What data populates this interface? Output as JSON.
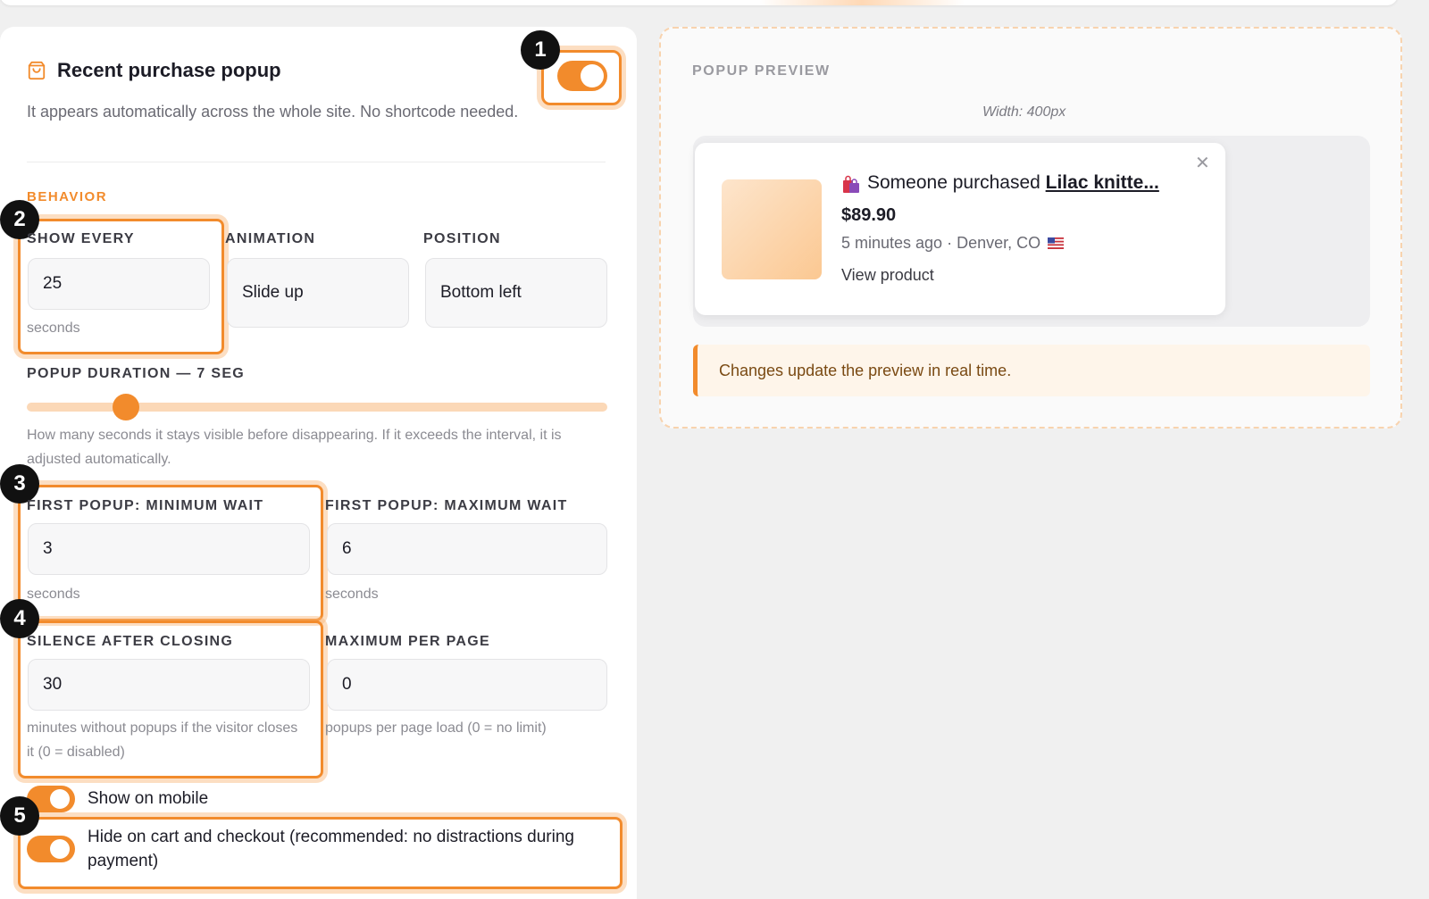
{
  "header": {
    "title": "Recent purchase popup",
    "subtitle": "It appears automatically across the whole site. No shortcode needed.",
    "enabled": true
  },
  "badges": [
    "1",
    "2",
    "3",
    "4",
    "5"
  ],
  "behavior": {
    "section_label": "BEHAVIOR",
    "show_every": {
      "label": "SHOW EVERY",
      "value": "25",
      "hint": "seconds"
    },
    "animation": {
      "label": "ANIMATION",
      "value": "Slide up"
    },
    "position": {
      "label": "POSITION",
      "value": "Bottom left"
    },
    "duration": {
      "label": "POPUP DURATION — 7 SEG",
      "value_fraction": 0.17,
      "hint": "How many seconds it stays visible before disappearing. If it exceeds the interval, it is adjusted automatically."
    },
    "first_min": {
      "label": "FIRST POPUP: MINIMUM WAIT",
      "value": "3",
      "hint": "seconds"
    },
    "first_max": {
      "label": "FIRST POPUP: MAXIMUM WAIT",
      "value": "6",
      "hint": "seconds"
    },
    "silence": {
      "label": "SILENCE AFTER CLOSING",
      "value": "30",
      "hint": "minutes without popups if the visitor closes it (0 = disabled)"
    },
    "max_per_page": {
      "label": "MAXIMUM PER PAGE",
      "value": "0",
      "hint": "popups per page load (0 = no limit)"
    },
    "show_mobile": {
      "label": "Show on mobile",
      "enabled": true
    },
    "hide_cart": {
      "label": "Hide on cart and checkout (recommended: no distractions during payment)",
      "enabled": true
    }
  },
  "preview": {
    "label": "POPUP PREVIEW",
    "width_text": "Width: 400px",
    "popup": {
      "prefix": "Someone purchased ",
      "product": "Lilac knitte...",
      "price": "$89.90",
      "meta": "5 minutes ago · Denver, CO",
      "link": "View product"
    },
    "notice": "Changes update the preview in real time."
  },
  "colors": {
    "accent": "#f28b2c",
    "accent_light": "#fbd8b7",
    "notice_bg": "#fef5ea"
  }
}
